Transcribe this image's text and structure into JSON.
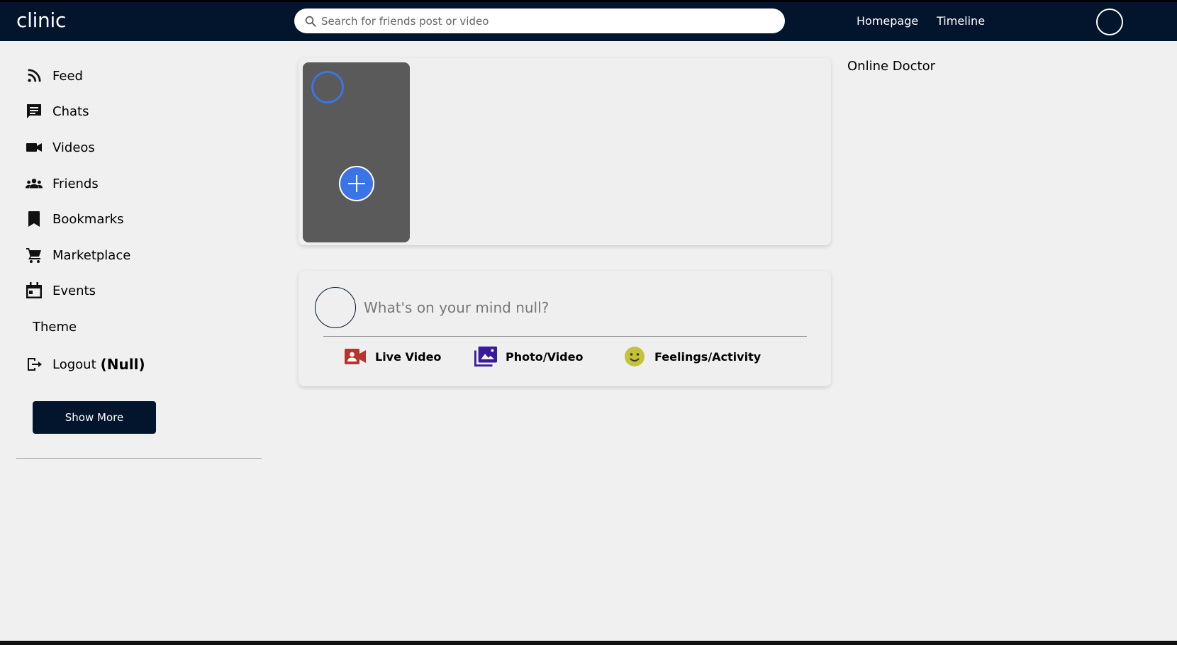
{
  "app": {
    "logo": "clinic"
  },
  "search": {
    "placeholder": "Search for friends post or video"
  },
  "nav": {
    "homepage": "Homepage",
    "timeline": "Timeline"
  },
  "sidebar": {
    "items": [
      {
        "label": "Feed",
        "icon": "rss-feed-icon"
      },
      {
        "label": "Chats",
        "icon": "chat-icon"
      },
      {
        "label": "Videos",
        "icon": "video-camera-icon"
      },
      {
        "label": "Friends",
        "icon": "group-icon"
      },
      {
        "label": "Bookmarks",
        "icon": "bookmark-icon"
      },
      {
        "label": "Marketplace",
        "icon": "shopping-cart-icon"
      },
      {
        "label": "Events",
        "icon": "calendar-icon"
      },
      {
        "label": "Theme"
      },
      {
        "label": "Logout",
        "user": "(Null)",
        "icon": "logout-icon"
      }
    ],
    "show_more": "Show More"
  },
  "share": {
    "placeholder": "What's on your mind null?",
    "actions": [
      {
        "label": "Live Video",
        "icon": "live-video-icon",
        "color": "#b9322c"
      },
      {
        "label": "Photo/Video",
        "icon": "photo-library-icon",
        "color": "#3a1a9c"
      },
      {
        "label": "Feelings/Activity",
        "icon": "smiley-icon",
        "color": "#c3c23a"
      }
    ]
  },
  "rightbar": {
    "title": "Online Doctor"
  },
  "colors": {
    "header": "#03142d",
    "accent": "#3b74e6",
    "background": "#f0f0f0"
  }
}
